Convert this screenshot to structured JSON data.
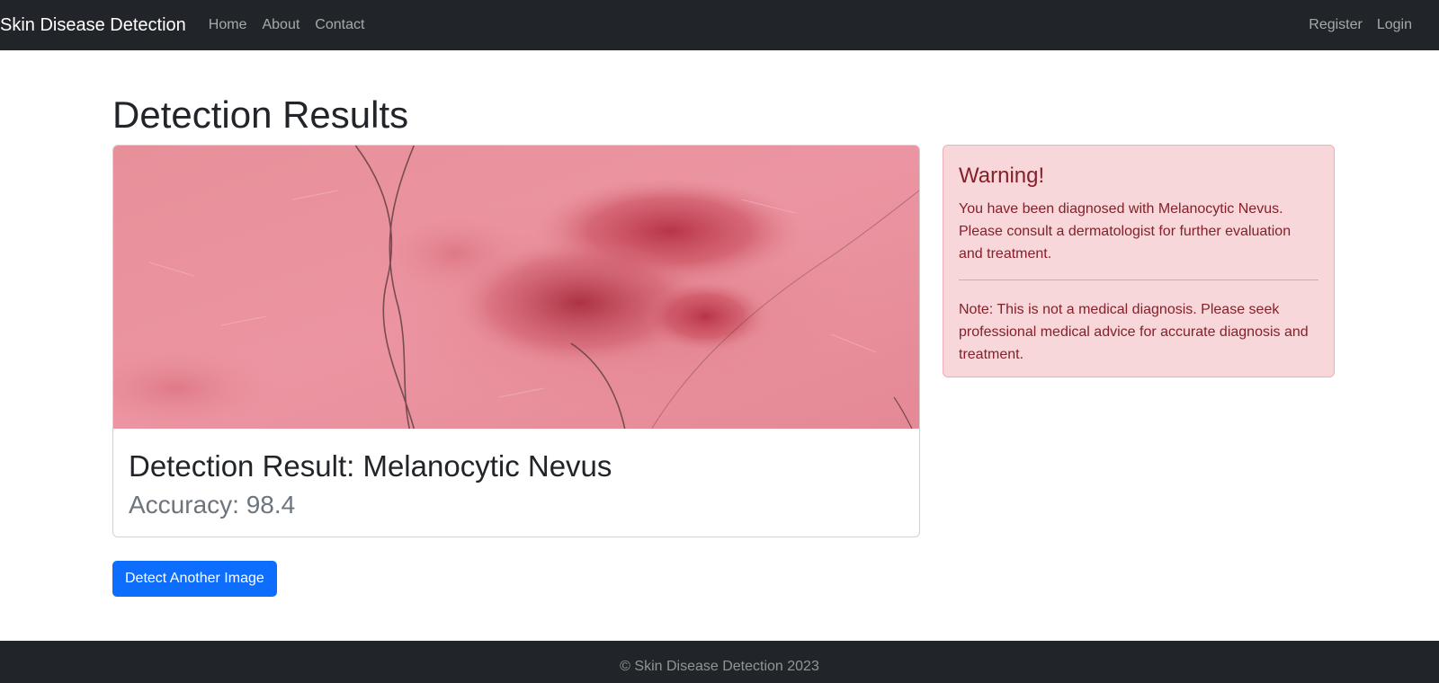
{
  "navbar": {
    "brand": "Skin Disease Detection",
    "links": [
      "Home",
      "About",
      "Contact"
    ],
    "right_links": [
      "Register",
      "Login"
    ]
  },
  "main": {
    "title": "Detection Results",
    "result": {
      "label": "Detection Result: Melanocytic Nevus",
      "accuracy": "Accuracy: 98.4"
    },
    "alert": {
      "heading": "Warning!",
      "message": "You have been diagnosed with Melanocytic Nevus. Please consult a dermatologist for further evaluation and treatment.",
      "note": "Note: This is not a medical diagnosis. Please seek professional medical advice for accurate diagnosis and treatment."
    },
    "action_button": "Detect Another Image"
  },
  "footer": {
    "text": "© Skin Disease Detection 2023"
  },
  "colors": {
    "navbar_bg": "#212529",
    "primary": "#0d6efd",
    "alert_bg": "#f8d7da",
    "alert_text": "#842029"
  }
}
